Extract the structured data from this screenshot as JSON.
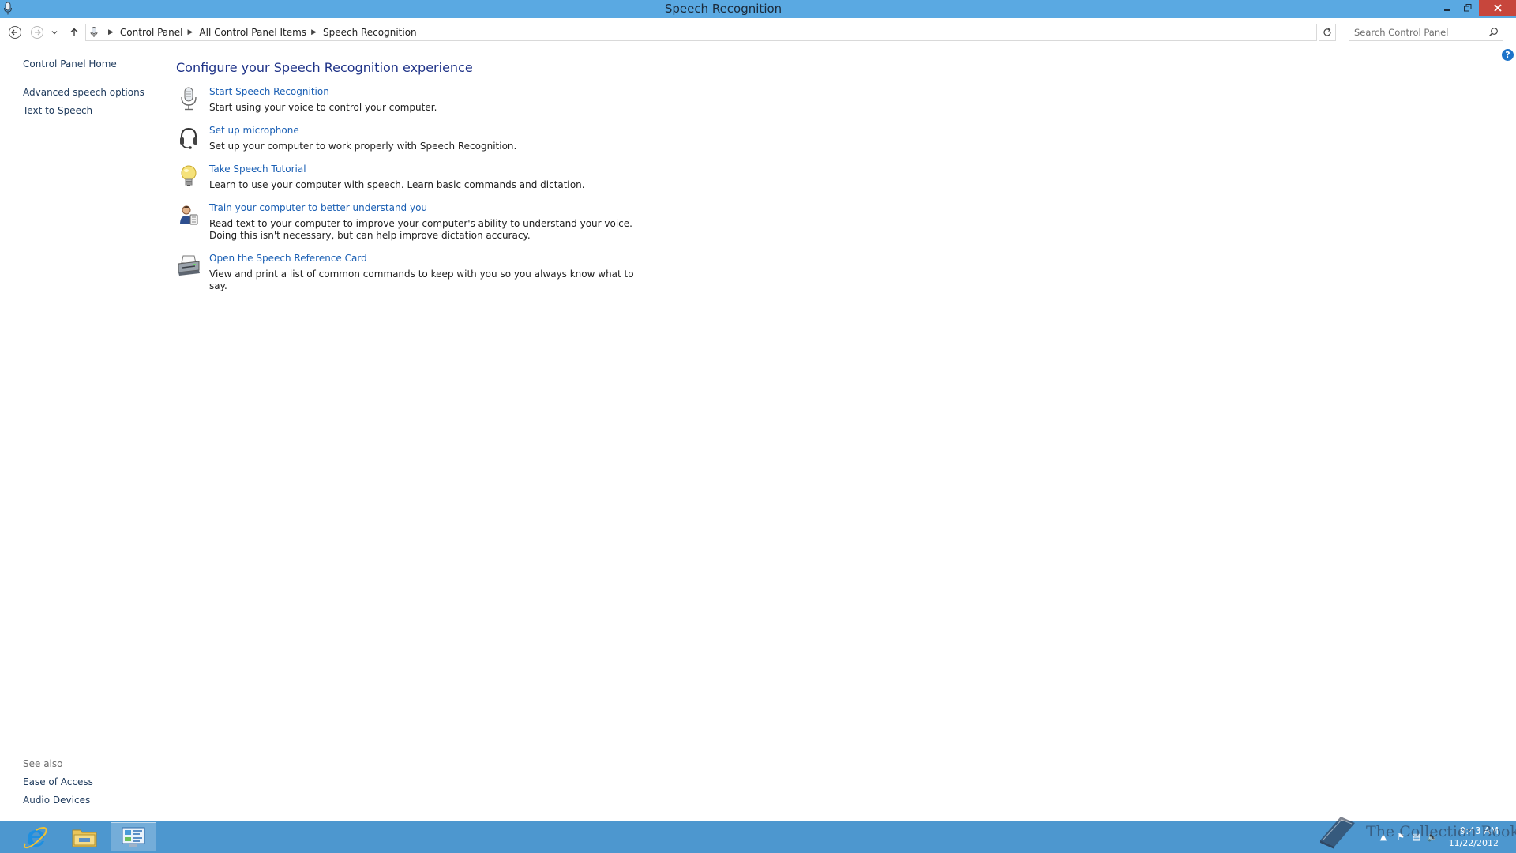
{
  "window": {
    "title": "Speech Recognition"
  },
  "address": {
    "breadcrumbs": [
      "Control Panel",
      "All Control Panel Items",
      "Speech Recognition"
    ],
    "search_placeholder": "Search Control Panel"
  },
  "left_pane": {
    "home_link": "Control Panel Home",
    "links": [
      "Advanced speech options",
      "Text to Speech"
    ],
    "see_also_label": "See also",
    "see_also_links": [
      "Ease of Access",
      "Audio Devices"
    ]
  },
  "main": {
    "heading": "Configure your Speech Recognition experience",
    "tasks": [
      {
        "icon": "microphone-icon",
        "link": "Start Speech Recognition",
        "description": "Start using your voice to control your computer."
      },
      {
        "icon": "headset-icon",
        "link": "Set up microphone",
        "description": "Set up your computer to work properly with Speech Recognition."
      },
      {
        "icon": "lightbulb-icon",
        "link": "Take Speech Tutorial",
        "description": "Learn to use your computer with speech.  Learn basic commands and dictation."
      },
      {
        "icon": "user-train-icon",
        "link": "Train your computer to better understand you",
        "description": "Read text to your computer to improve your computer's ability to understand your voice.  Doing this isn't necessary, but can help improve dictation accuracy."
      },
      {
        "icon": "printer-icon",
        "link": "Open the Speech Reference Card",
        "description": "View and print a list of common commands to keep with you so you always know what to say."
      }
    ]
  },
  "taskbar": {
    "apps": [
      "internet-explorer-icon",
      "file-explorer-icon",
      "control-panel-icon"
    ],
    "active_app": "control-panel-icon",
    "clock_time": "9:43 AM",
    "clock_date": "11/22/2012",
    "watermark": "The Collection Book"
  },
  "colors": {
    "titlebar": "#5aa9e2",
    "taskbar": "#4d97cf",
    "link": "#1a5fb4",
    "heading": "#1e3287",
    "close_button": "#c7463c"
  }
}
